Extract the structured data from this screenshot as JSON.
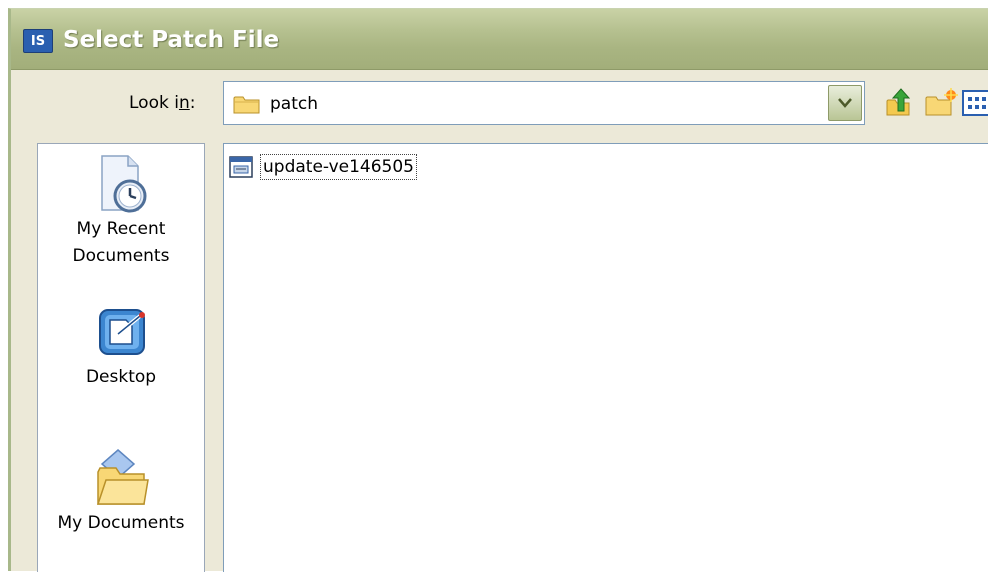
{
  "window": {
    "title": "Select Patch File",
    "app_icon_text": "IS",
    "colors": {
      "titlebar": "#b6c190",
      "face": "#ece9d8",
      "border": "#7f9db9"
    }
  },
  "lookin": {
    "label": "Look in:",
    "value": "patch",
    "icon": "folder-icon"
  },
  "toolbar": {
    "buttons": [
      {
        "name": "up-one-level",
        "icon": "up-arrow-icon"
      },
      {
        "name": "create-new-folder",
        "icon": "new-folder-icon"
      },
      {
        "name": "view-menu",
        "icon": "view-menu-icon"
      }
    ]
  },
  "places": [
    {
      "label_line1": "My Recent",
      "label_line2": "Documents",
      "icon": "recent-documents-icon"
    },
    {
      "label_line1": "Desktop",
      "label_line2": "",
      "icon": "desktop-icon"
    },
    {
      "label_line1": "My Documents",
      "label_line2": "",
      "icon": "my-documents-icon"
    }
  ],
  "files": [
    {
      "name": "update-ve146505",
      "icon": "patch-file-icon",
      "selected": true
    }
  ]
}
